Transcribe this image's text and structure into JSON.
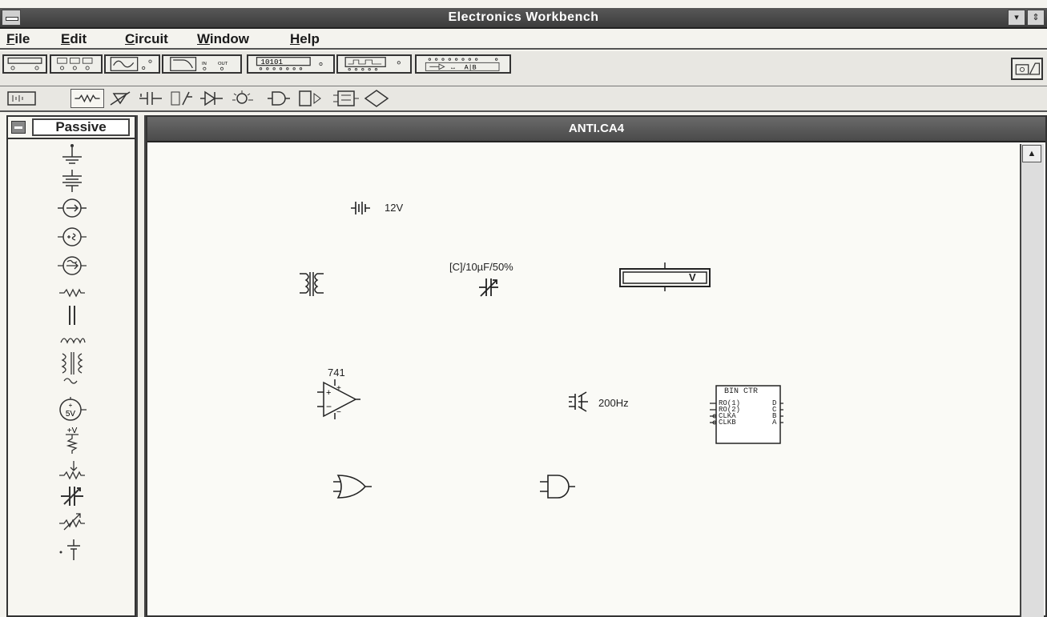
{
  "window": {
    "title": "Electronics Workbench",
    "minimize_glyph": "▾",
    "restore_glyph": "⇕"
  },
  "menu": [
    {
      "label": "File",
      "mnemonic": "F"
    },
    {
      "label": "Edit",
      "mnemonic": "E"
    },
    {
      "label": "Circuit",
      "mnemonic": "C"
    },
    {
      "label": "Window",
      "mnemonic": "W"
    },
    {
      "label": "Help",
      "mnemonic": "H"
    }
  ],
  "instrument_toolbar": {
    "word_generator_label": "10101",
    "logic_converter_label": "A|B"
  },
  "component_toolbar": [
    "battery-bin-icon",
    "passive-bin-icon",
    "active-bin-icon",
    "controls-bin-icon",
    "hybrid-bin-icon",
    "diodes-bin-icon",
    "indicators-bin-icon",
    "gates-bin-icon",
    "combinational-bin-icon",
    "sequential-bin-icon",
    "digital-ic-bin-icon"
  ],
  "parts_bin": {
    "title": "Passive",
    "items": [
      "ground-icon",
      "battery-icon",
      "dc-current-source-icon",
      "ac-voltage-source-icon",
      "ac-current-source-icon",
      "resistor-icon",
      "capacitor-icon",
      "inductor-icon",
      "transformer-icon",
      "vcc-source-icon",
      "vcc-supply-icon",
      "potentiometer-icon",
      "variable-capacitor-icon",
      "variable-resistor-icon",
      "switch-icon"
    ],
    "vcc_label": "5V",
    "supply_label": "+V"
  },
  "circuit_window": {
    "title": "ANTI.CA4",
    "scroll_up_glyph": "▲"
  },
  "parts": {
    "battery_value": "12V",
    "capacitor_value": "[C]/10µF/50%",
    "voltmeter_unit": "V",
    "opamp_label": "741",
    "function_gen_value": "200Hz",
    "counter": {
      "title": "BIN CTR",
      "pins_left": [
        "RO(1)",
        "RO(2)",
        "CLKA",
        "CLKB"
      ],
      "pins_right": [
        "D",
        "C",
        "B",
        "A"
      ]
    }
  }
}
